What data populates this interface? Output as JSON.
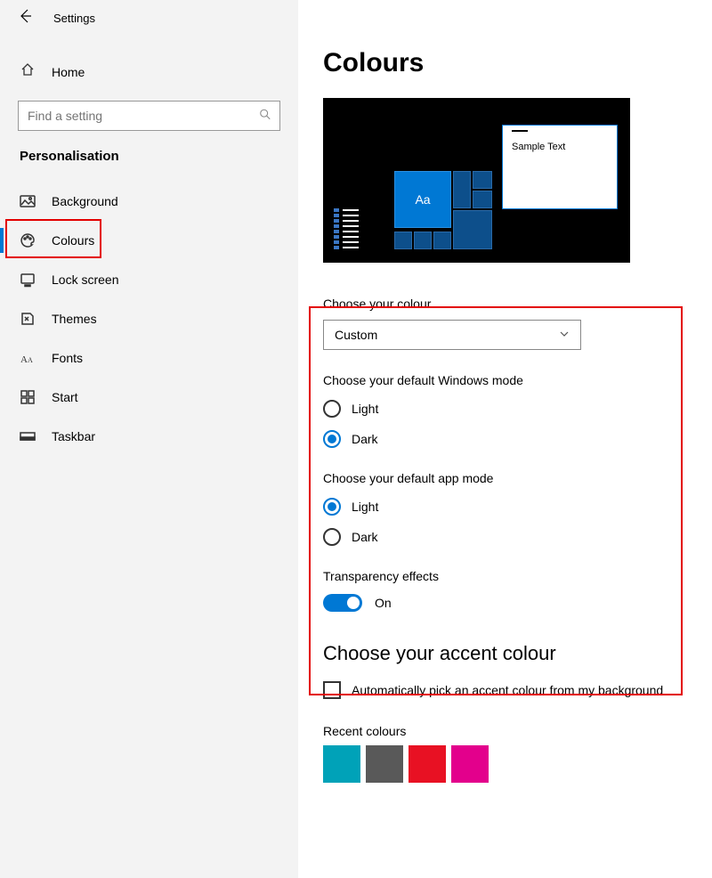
{
  "window_title": "Settings",
  "home_label": "Home",
  "search_placeholder": "Find a setting",
  "section_header": "Personalisation",
  "nav": [
    {
      "label": "Background",
      "selected": false
    },
    {
      "label": "Colours",
      "selected": true
    },
    {
      "label": "Lock screen",
      "selected": false
    },
    {
      "label": "Themes",
      "selected": false
    },
    {
      "label": "Fonts",
      "selected": false
    },
    {
      "label": "Start",
      "selected": false
    },
    {
      "label": "Taskbar",
      "selected": false
    }
  ],
  "page_title": "Colours",
  "preview": {
    "sample_text": "Sample Text",
    "tile_glyph": "Aa"
  },
  "choose_colour": {
    "label": "Choose your colour",
    "value": "Custom"
  },
  "windows_mode": {
    "label": "Choose your default Windows mode",
    "options": {
      "light": "Light",
      "dark": "Dark"
    },
    "selected": "dark"
  },
  "app_mode": {
    "label": "Choose your default app mode",
    "options": {
      "light": "Light",
      "dark": "Dark"
    },
    "selected": "light"
  },
  "transparency": {
    "label": "Transparency effects",
    "state_label": "On",
    "on": true
  },
  "accent": {
    "title": "Choose your accent colour",
    "auto_label": "Automatically pick an accent colour from my background",
    "auto_checked": false,
    "recent_label": "Recent colours",
    "recent_colours": [
      "#00a2b8",
      "#595959",
      "#e81123",
      "#e3008c"
    ]
  }
}
